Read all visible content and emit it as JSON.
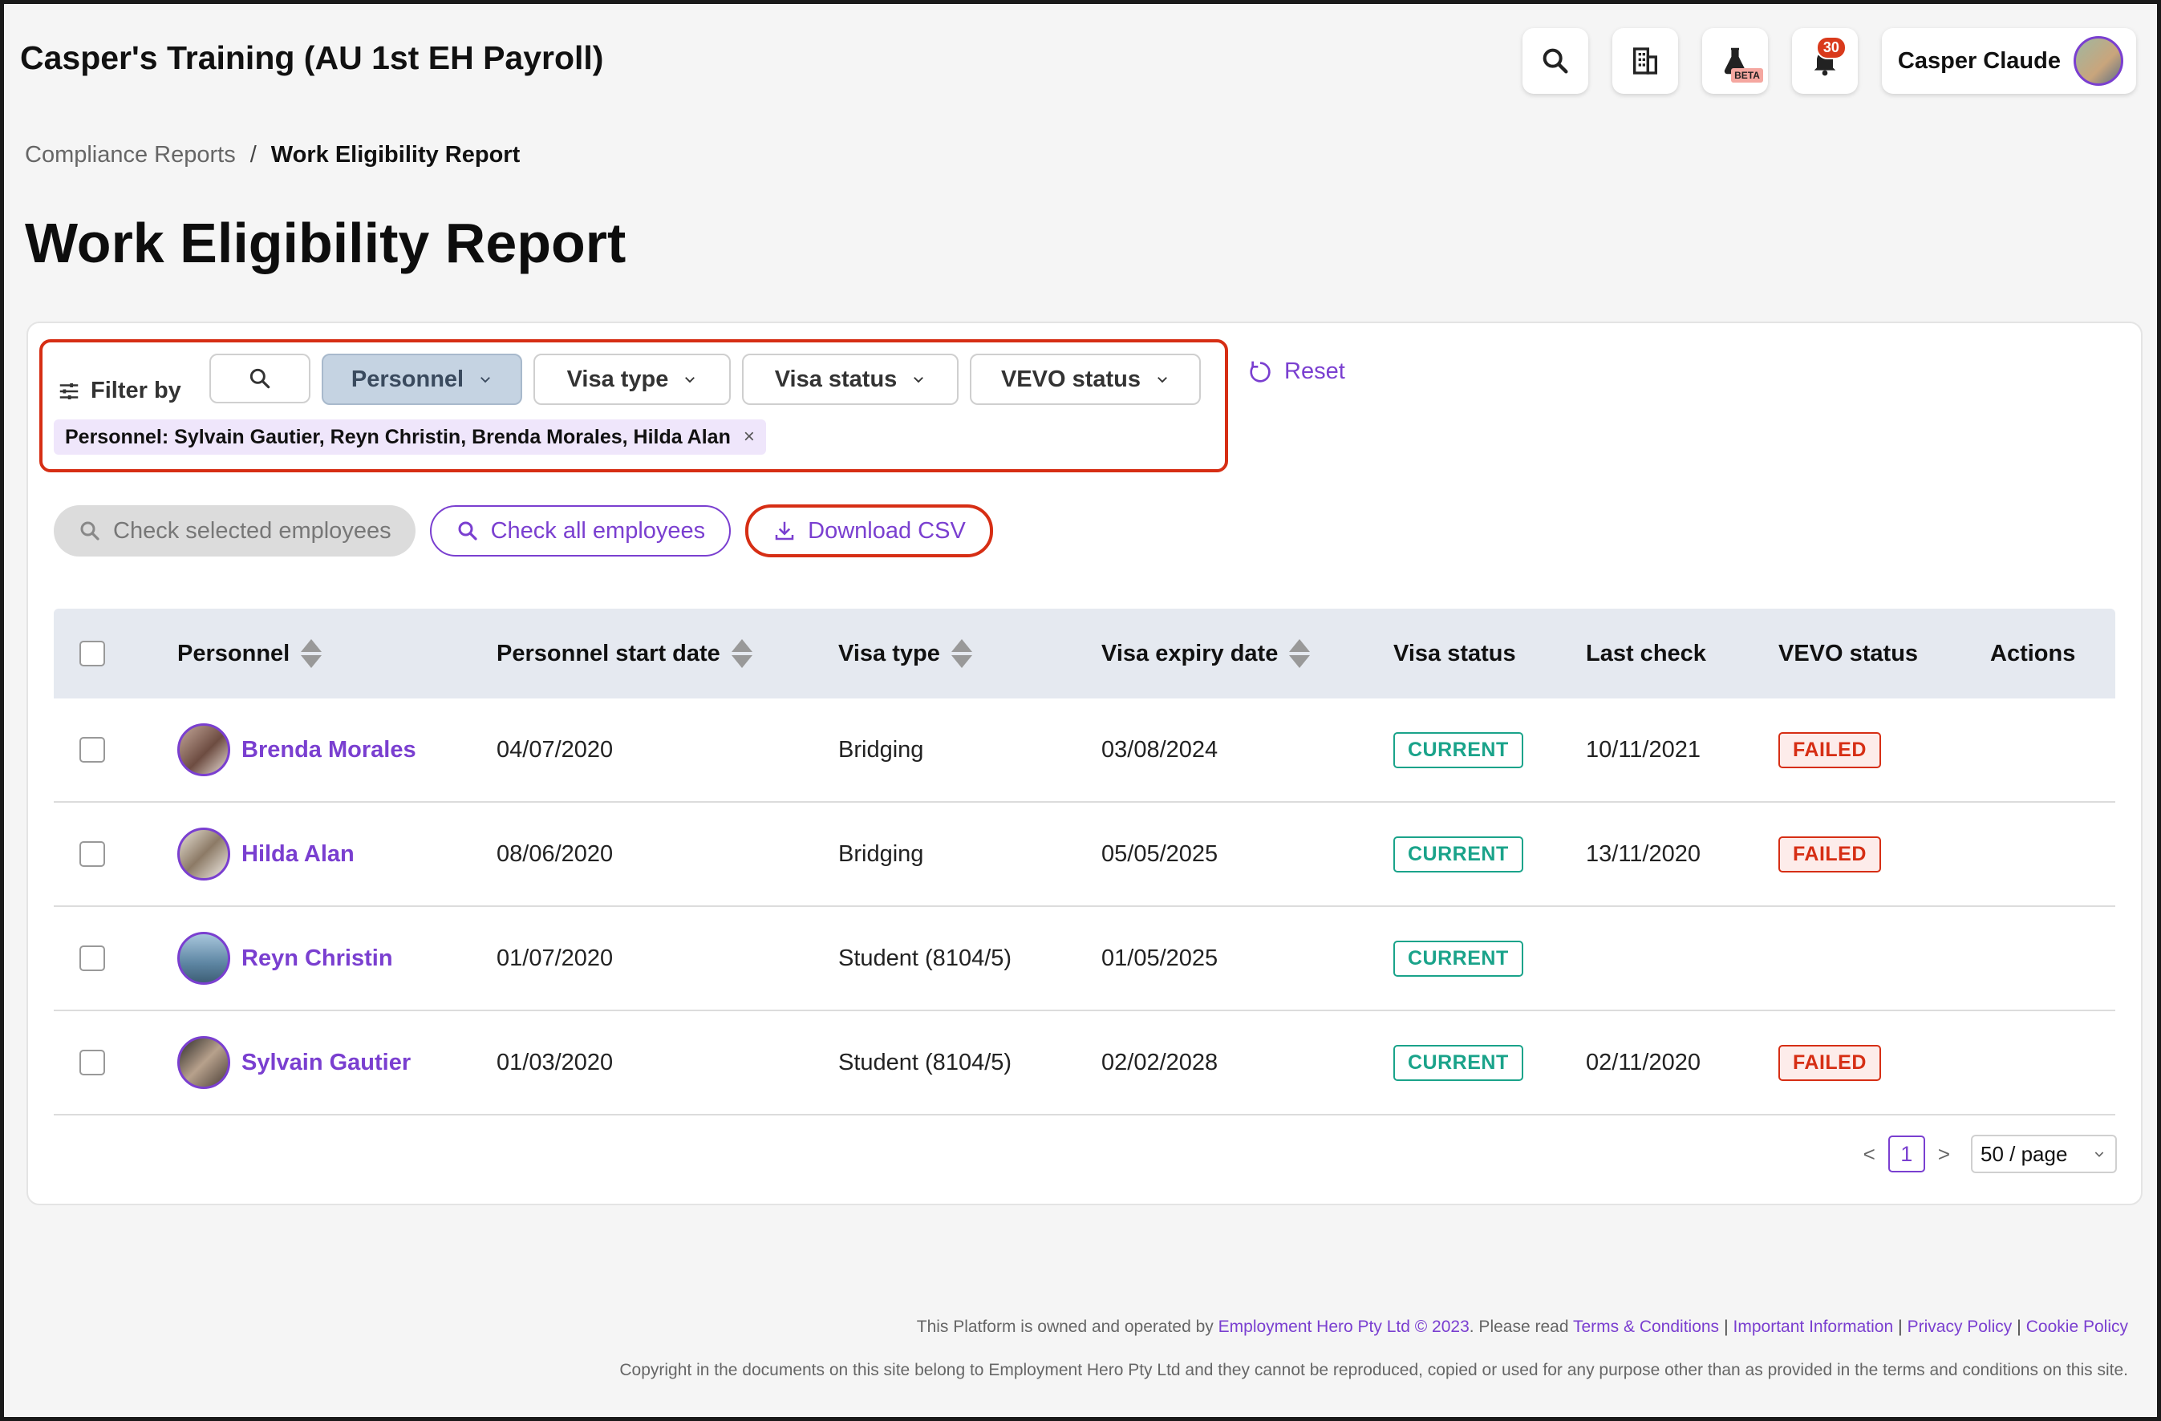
{
  "app": {
    "title": "Casper's Training (AU 1st EH Payroll)"
  },
  "topbar": {
    "beta_label": "BETA",
    "notification_count": "30",
    "user_name": "Casper Claude"
  },
  "breadcrumb": {
    "parent": "Compliance Reports",
    "separator": "/",
    "current": "Work Eligibility Report"
  },
  "page_title": "Work Eligibility Report",
  "filters": {
    "label": "Filter by",
    "personnel": "Personnel",
    "visa_type": "Visa type",
    "visa_status": "Visa status",
    "vevo_status": "VEVO status",
    "chip": "Personnel: Sylvain Gautier, Reyn Christin, Brenda Morales, Hilda Alan",
    "chip_close": "×",
    "reset": "Reset"
  },
  "actions": {
    "check_selected": "Check selected employees",
    "check_all": "Check all employees",
    "download_csv": "Download CSV"
  },
  "table": {
    "headers": {
      "personnel": "Personnel",
      "start_date": "Personnel start date",
      "visa_type": "Visa type",
      "visa_expiry": "Visa expiry date",
      "visa_status": "Visa status",
      "last_check": "Last check",
      "vevo_status": "VEVO status",
      "actions": "Actions"
    },
    "rows": [
      {
        "name": "Brenda Morales",
        "start": "04/07/2020",
        "visa_type": "Bridging",
        "expiry": "03/08/2024",
        "visa_status": "CURRENT",
        "last_check": "10/11/2021",
        "vevo": "FAILED"
      },
      {
        "name": "Hilda Alan",
        "start": "08/06/2020",
        "visa_type": "Bridging",
        "expiry": "05/05/2025",
        "visa_status": "CURRENT",
        "last_check": "13/11/2020",
        "vevo": "FAILED"
      },
      {
        "name": "Reyn Christin",
        "start": "01/07/2020",
        "visa_type": "Student (8104/5)",
        "expiry": "01/05/2025",
        "visa_status": "CURRENT",
        "last_check": "",
        "vevo": ""
      },
      {
        "name": "Sylvain Gautier",
        "start": "01/03/2020",
        "visa_type": "Student (8104/5)",
        "expiry": "02/02/2028",
        "visa_status": "CURRENT",
        "last_check": "02/11/2020",
        "vevo": "FAILED"
      }
    ]
  },
  "pagination": {
    "prev": "<",
    "current": "1",
    "next": ">",
    "page_size": "50 / page"
  },
  "footer": {
    "line1_prefix": "This Platform is owned and operated by",
    "company_link": "Employment Hero Pty Ltd © 2023",
    "line1_mid": ". Please read",
    "terms": "Terms & Conditions",
    "important": "Important Information",
    "privacy": "Privacy Policy",
    "cookie": "Cookie Policy",
    "copyright": "Copyright in the documents on this site belong to Employment Hero Pty Ltd and they cannot be reproduced, copied or used for any purpose other than as provided in the terms and conditions on this site."
  },
  "colors": {
    "accent": "#7a3fd0",
    "highlight": "#d62e14",
    "current": "#1aa38a",
    "failed": "#d62e14"
  }
}
